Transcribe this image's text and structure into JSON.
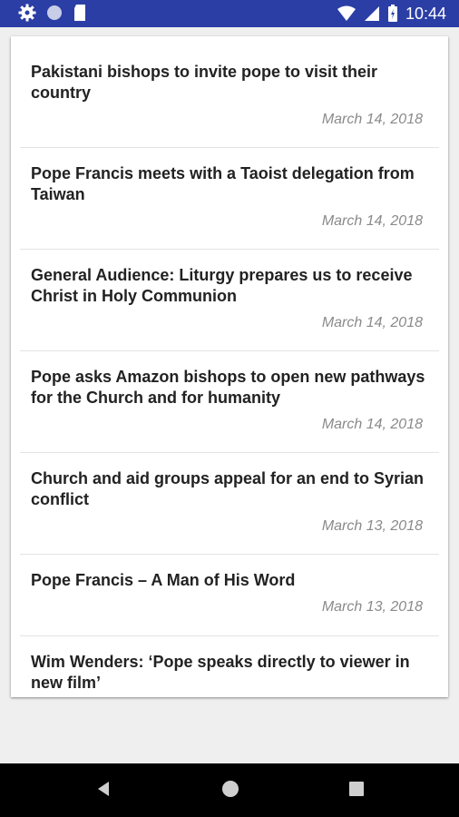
{
  "status_bar": {
    "time": "10:44",
    "left_icons": [
      "gear-icon",
      "circle-icon",
      "sd-card-icon"
    ],
    "right_icons": [
      "wifi-icon",
      "signal-icon",
      "battery-icon"
    ],
    "color": "#2b3ea6"
  },
  "articles": [
    {
      "title": "Pakistani bishops to invite pope to visit their country",
      "date": "March 14, 2018"
    },
    {
      "title": "Pope Francis meets with a Taoist delegation from Taiwan",
      "date": "March 14, 2018"
    },
    {
      "title": "General Audience: Liturgy prepares us to receive Christ in Holy Communion",
      "date": "March 14, 2018"
    },
    {
      "title": "Pope asks Amazon bishops to open new pathways for the Church and for humanity",
      "date": "March 14, 2018"
    },
    {
      "title": "Church and aid groups appeal for an end to Syrian conflict",
      "date": "March 13, 2018"
    },
    {
      "title": "Pope Francis – A Man of His Word",
      "date": "March 13, 2018"
    },
    {
      "title": "Wim Wenders: ‘Pope speaks directly to viewer in new film’",
      "date": ""
    }
  ],
  "nav_bar": {
    "buttons": [
      "back-icon",
      "home-icon",
      "recents-icon"
    ]
  }
}
